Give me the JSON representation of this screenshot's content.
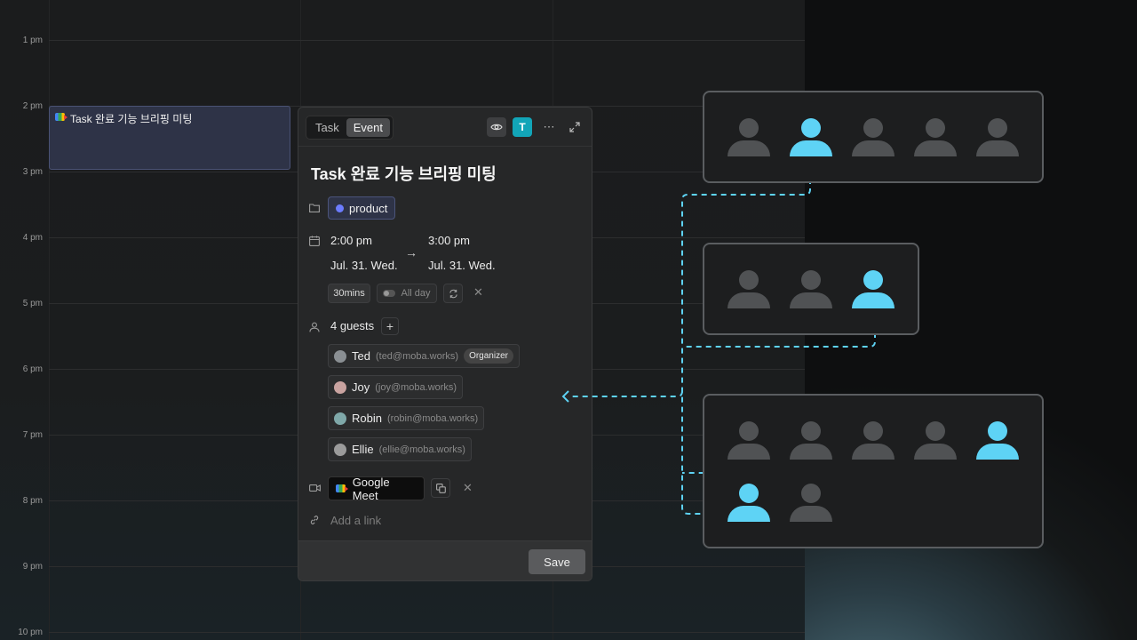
{
  "calendar": {
    "hours": [
      "1 pm",
      "2 pm",
      "3 pm",
      "4 pm",
      "5 pm",
      "6 pm",
      "7 pm",
      "8 pm",
      "9 pm",
      "10 pm"
    ],
    "event": {
      "title": "Task 완료 기능 브리핑 미팅",
      "icon": "google-meet-icon"
    }
  },
  "panel": {
    "tabs": [
      "Task",
      "Event"
    ],
    "active_tab": "Event",
    "avatar_letter": "T",
    "title": "Task 완료 기능 브리핑 미팅",
    "project": {
      "label": "product",
      "color": "#6c7cff"
    },
    "start": {
      "time": "2:00 pm",
      "date": "Jul. 31. Wed."
    },
    "end": {
      "time": "3:00 pm",
      "date": "Jul. 31. Wed."
    },
    "duration": "30mins",
    "all_day_label": "All day",
    "guests_label": "4 guests",
    "guests": [
      {
        "name": "Ted",
        "email": "(ted@moba.works)",
        "badge": "Organizer",
        "avatar_color": "#8a8f93"
      },
      {
        "name": "Joy",
        "email": "(joy@moba.works)",
        "badge": "",
        "avatar_color": "#c9a3a0"
      },
      {
        "name": "Robin",
        "email": "(robin@moba.works)",
        "badge": "",
        "avatar_color": "#7fa8a9"
      },
      {
        "name": "Ellie",
        "email": "(ellie@moba.works)",
        "badge": "",
        "avatar_color": "#9b9b9b"
      }
    ],
    "meeting": {
      "label": "Google Meet"
    },
    "link_placeholder": "Add a link",
    "save_label": "Save"
  },
  "teams": [
    {
      "members": [
        "grey",
        "cyan",
        "grey",
        "grey",
        "grey"
      ]
    },
    {
      "members": [
        "grey",
        "grey",
        "cyan"
      ]
    },
    {
      "members": [
        "grey",
        "grey",
        "grey",
        "grey",
        "cyan",
        "cyan",
        "grey"
      ]
    }
  ],
  "colors": {
    "accent": "#5ed3f5",
    "brand": "#12a5b8",
    "event_bg": "#2e3347"
  }
}
